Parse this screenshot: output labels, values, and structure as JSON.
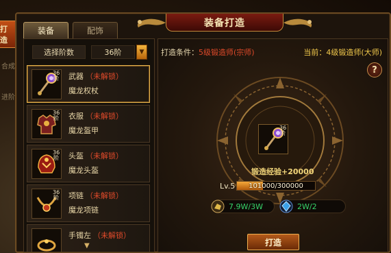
{
  "window": {
    "title": "装备打造"
  },
  "side": {
    "active_tab": "打造",
    "tab2": "合成",
    "tab3": "进阶"
  },
  "tabs": [
    {
      "label": "装备",
      "active": true
    },
    {
      "label": "配饰",
      "active": false
    }
  ],
  "stage_filter": {
    "label": "选择阶数",
    "value": "36阶"
  },
  "items": [
    {
      "slot": "武器",
      "lock": "（未解锁）",
      "name": "魔龙权杖",
      "level": "36阶",
      "selected": true,
      "icon": "scepter-icon"
    },
    {
      "slot": "衣服",
      "lock": "（未解锁）",
      "name": "魔龙盔甲",
      "level": "36阶",
      "selected": false,
      "icon": "armor-icon"
    },
    {
      "slot": "头盔",
      "lock": "（未解锁）",
      "name": "魔龙头盔",
      "level": "36阶",
      "selected": false,
      "icon": "helmet-icon"
    },
    {
      "slot": "项链",
      "lock": "（未解锁）",
      "name": "魔龙项链",
      "level": "36阶",
      "selected": false,
      "icon": "necklace-icon"
    },
    {
      "slot": "手镯左",
      "lock": "（未解锁）",
      "name": "",
      "level": "",
      "selected": false,
      "icon": "bracelet-icon"
    }
  ],
  "forge": {
    "condition_label": "打造条件：",
    "condition_value": "5级锻造师(宗师)",
    "current": "当前：4级锻造师(大师)",
    "help": "?",
    "item_level": "36阶",
    "exp_text": "锻造经验+20000",
    "level_label": "Lv.5",
    "progress_text": "101000/300000",
    "progress": 0.3367,
    "materials": [
      {
        "icon": "ore-icon",
        "count": "7.9W/3W"
      },
      {
        "icon": "gem-icon",
        "count": "2W/2"
      }
    ],
    "button": "打造"
  },
  "colors": {
    "accent": "#e6b34c",
    "lock": "#e04a2a",
    "ok": "#36d46a",
    "gold": "#f2c94c"
  }
}
